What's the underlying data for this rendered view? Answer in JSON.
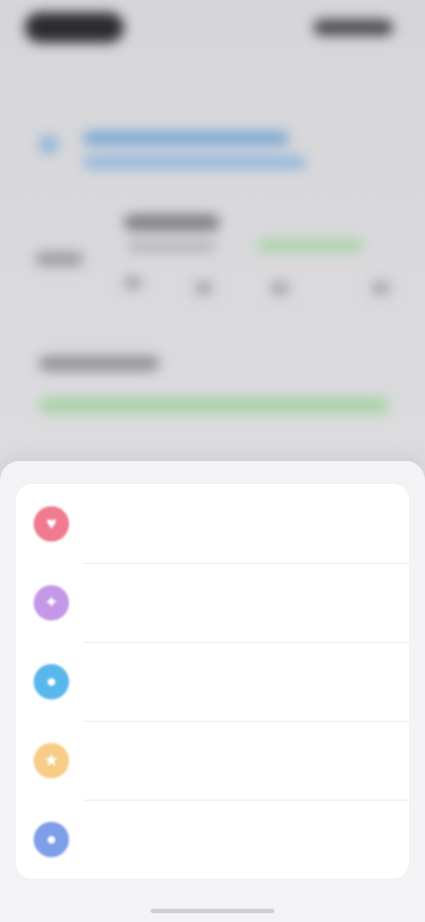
{
  "background_app": {
    "progress_fraction": 1.0,
    "progress_color": "#a8d2a5",
    "link_color": "#7aa7d2"
  },
  "sheet": {
    "items": [
      {
        "label": "",
        "icon": "heart-icon",
        "color": "#f07a8e"
      },
      {
        "label": "",
        "icon": "sparkle-icon",
        "color": "#c398e8"
      },
      {
        "label": "",
        "icon": "chat-icon",
        "color": "#58b8ec"
      },
      {
        "label": "",
        "icon": "star-icon",
        "color": "#f6cc86"
      },
      {
        "label": "",
        "icon": "user-icon",
        "color": "#7f9ee8"
      }
    ]
  }
}
